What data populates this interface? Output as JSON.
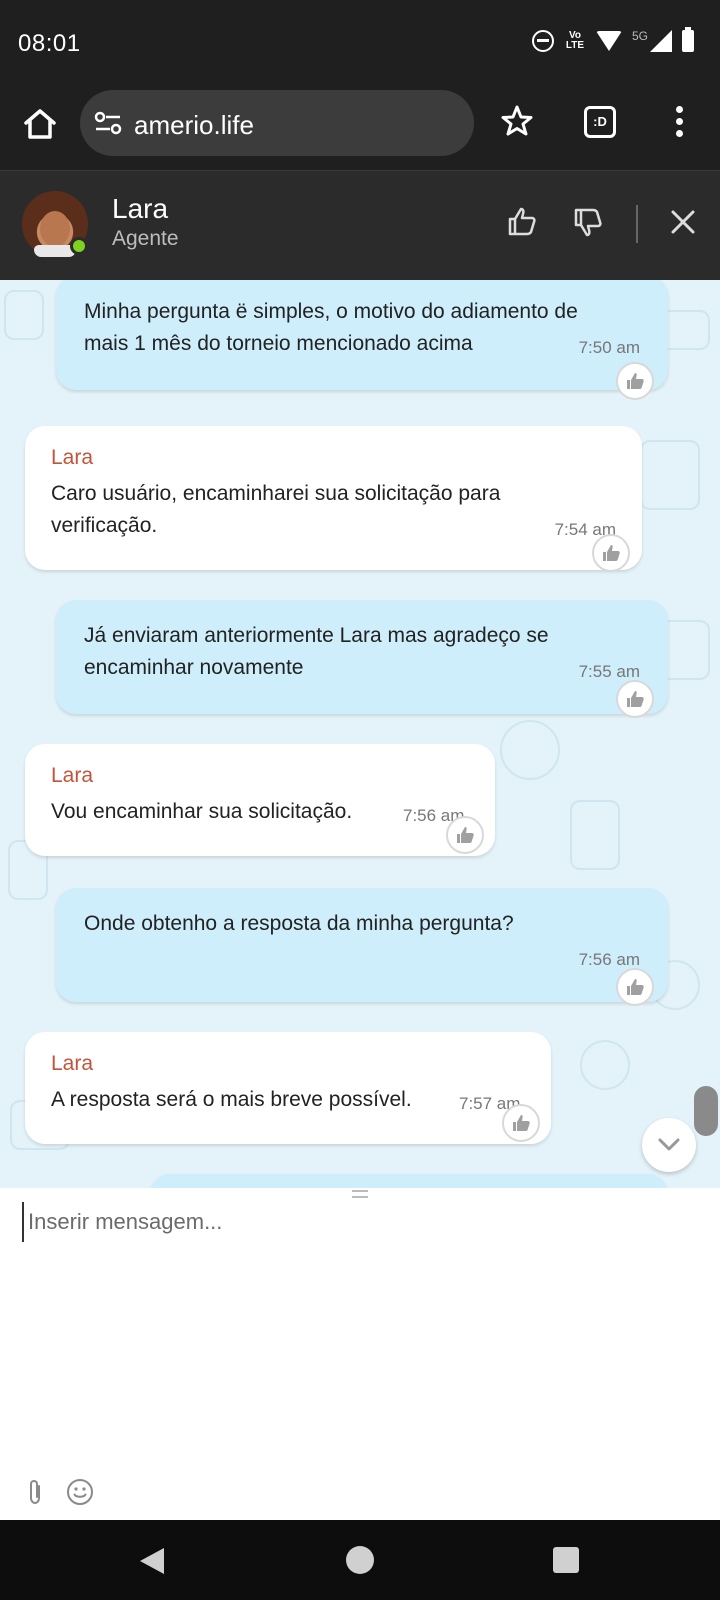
{
  "status_bar": {
    "time": "08:01",
    "network_type": "5G",
    "volte_label": "Vo LTE"
  },
  "browser": {
    "url": "amerio.life",
    "tab_count_label": ":D"
  },
  "chat_header": {
    "agent_name": "Lara",
    "agent_role": "Agente",
    "online_color": "#7ed321"
  },
  "messages": [
    {
      "from": "user",
      "text": "Minha pergunta ë simples, o motivo do adiamento de mais 1 mês do torneio mencionado acima",
      "time": "7:50 am"
    },
    {
      "from": "agent",
      "sender": "Lara",
      "text": "Caro usuário, encaminharei sua solicitação para verificação.",
      "time": "7:54 am"
    },
    {
      "from": "user",
      "text": "Já enviaram anteriormente Lara mas agradeço se encaminhar novamente",
      "time": "7:55 am"
    },
    {
      "from": "agent",
      "sender": "Lara",
      "text": "Vou encaminhar sua solicitação.",
      "time": "7:56 am"
    },
    {
      "from": "user",
      "text": "Onde obtenho a resposta da minha pergunta?",
      "time": "7:56 am"
    },
    {
      "from": "agent",
      "sender": "Lara",
      "text": "A resposta será o mais breve possível.",
      "time": "7:57 am"
    }
  ],
  "composer": {
    "placeholder": "Inserir mensagem..."
  },
  "colors": {
    "user_bubble": "#cfeefb",
    "agent_bubble": "#ffffff",
    "sender_name": "#c1543a",
    "chat_background": "#e4f3f9"
  }
}
